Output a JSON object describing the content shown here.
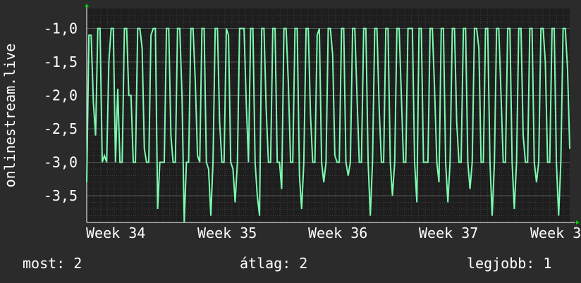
{
  "chart_data": {
    "type": "line",
    "title": "",
    "ylabel": "onlinestream.live",
    "xlabel": "",
    "x_ticks": [
      "Week 34",
      "Week 35",
      "Week 36",
      "Week 37",
      "Week 3"
    ],
    "y_ticks": [
      "-1,0",
      "-1,5",
      "-2,0",
      "-2,5",
      "-3,0",
      "-3,5"
    ],
    "y_tick_values": [
      -1.0,
      -1.5,
      -2.0,
      -2.5,
      -3.0,
      -3.5
    ],
    "ylim": [
      -3.9,
      -0.7
    ],
    "grid": true,
    "series": [
      {
        "color": "#7dfcb0",
        "values": [
          -3.3,
          -1.1,
          -1.1,
          -2.1,
          -2.6,
          -1.0,
          -1.0,
          -3.0,
          -2.9,
          -3.0,
          -1.5,
          -1.0,
          -1.0,
          -3.0,
          -1.9,
          -3.0,
          -3.0,
          -1.0,
          -1.0,
          -2.0,
          -2.0,
          -3.0,
          -3.0,
          -1.0,
          -1.0,
          -1.3,
          -2.8,
          -3.0,
          -3.0,
          -1.1,
          -1.0,
          -1.0,
          -3.7,
          -3.0,
          -3.0,
          -3.0,
          -1.0,
          -1.0,
          -2.6,
          -3.0,
          -3.0,
          -1.0,
          -1.0,
          -2.0,
          -3.9,
          -3.0,
          -3.0,
          -1.0,
          -1.0,
          -1.8,
          -2.9,
          -3.0,
          -1.0,
          -1.0,
          -3.0,
          -3.1,
          -3.8,
          -3.0,
          -1.0,
          -1.0,
          -2.4,
          -3.0,
          -3.0,
          -1.0,
          -1.1,
          -3.0,
          -3.1,
          -3.6,
          -3.0,
          -1.0,
          -1.0,
          -1.0,
          -2.1,
          -3.0,
          -1.0,
          -1.0,
          -3.0,
          -3.5,
          -3.8,
          -1.0,
          -1.0,
          -2.2,
          -3.0,
          -3.0,
          -1.0,
          -1.0,
          -3.0,
          -3.0,
          -3.4,
          -1.0,
          -1.0,
          -1.8,
          -3.0,
          -3.0,
          -1.0,
          -1.0,
          -3.2,
          -3.7,
          -3.0,
          -1.0,
          -1.0,
          -2.3,
          -3.0,
          -3.0,
          -1.1,
          -1.0,
          -3.0,
          -3.3,
          -3.0,
          -1.0,
          -1.0,
          -1.4,
          -2.9,
          -3.0,
          -3.0,
          -1.0,
          -1.0,
          -3.0,
          -3.2,
          -3.0,
          -1.0,
          -1.0,
          -2.0,
          -3.0,
          -3.0,
          -1.0,
          -1.0,
          -3.0,
          -3.8,
          -3.0,
          -1.0,
          -1.0,
          -2.2,
          -3.0,
          -3.0,
          -1.0,
          -1.0,
          -3.0,
          -3.5,
          -3.0,
          -1.0,
          -1.0,
          -2.0,
          -3.0,
          -3.0,
          -1.0,
          -1.0,
          -1.0,
          -3.0,
          -3.6,
          -1.0,
          -1.0,
          -3.0,
          -3.0,
          -3.0,
          -1.0,
          -1.0,
          -1.9,
          -3.0,
          -3.3,
          -1.0,
          -1.0,
          -3.0,
          -3.6,
          -3.0,
          -1.0,
          -1.0,
          -2.4,
          -3.0,
          -3.0,
          -1.0,
          -1.0,
          -3.0,
          -3.4,
          -3.0,
          -1.0,
          -1.0,
          -1.3,
          -3.0,
          -3.0,
          -1.0,
          -1.0,
          -3.0,
          -3.8,
          -3.0,
          -1.0,
          -1.0,
          -2.0,
          -3.0,
          -3.0,
          -1.0,
          -1.0,
          -3.0,
          -3.7,
          -3.0,
          -1.0,
          -1.0,
          -2.6,
          -3.0,
          -3.0,
          -1.0,
          -1.0,
          -3.0,
          -3.3,
          -3.0,
          -1.0,
          -1.0,
          -1.5,
          -3.0,
          -3.0,
          -1.0,
          -1.0,
          -3.0,
          -3.8,
          -3.0,
          -1.0,
          -1.0,
          -1.6,
          -2.8
        ]
      }
    ]
  },
  "stats": {
    "now": "most: 2",
    "avg": "átlag: 2",
    "best": "legjobb: 1"
  },
  "colors": {
    "background": "#2b2b2b",
    "plot_background": "#1e1e1e",
    "grid": "#3c3c3c",
    "axis": "#ffffff",
    "arrow": "#00cc00",
    "line": "#7dfcb0"
  }
}
